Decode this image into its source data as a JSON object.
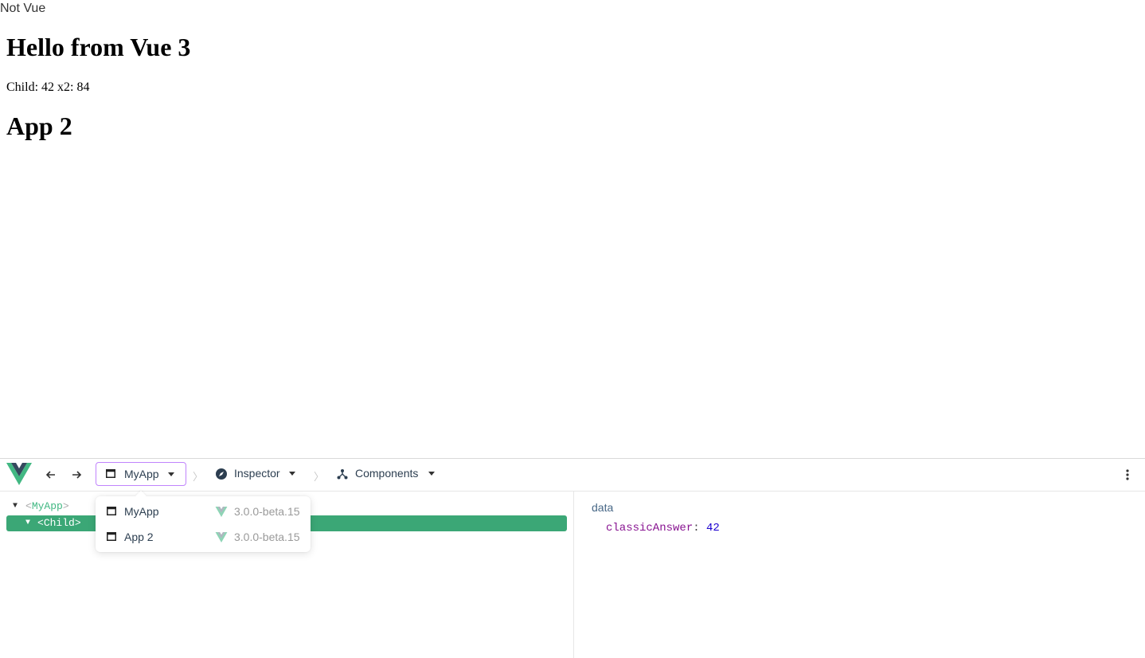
{
  "page": {
    "not_vue_text": "Not Vue",
    "heading": "Hello from Vue 3",
    "child_line": "Child: 42 x2: 84",
    "app2_heading": "App 2"
  },
  "devtools": {
    "toolbar": {
      "app_select_label": "MyApp",
      "inspector_label": "Inspector",
      "components_label": "Components",
      "separator": "〉"
    },
    "tree": {
      "root_tag": "MyApp",
      "child_tag": "Child"
    },
    "state": {
      "section_title": "data",
      "key": "classicAnswer",
      "value": "42"
    },
    "app_dropdown": [
      {
        "name": "MyApp",
        "version": "3.0.0-beta.15"
      },
      {
        "name": "App 2",
        "version": "3.0.0-beta.15"
      }
    ]
  },
  "colors": {
    "vue_green": "#42b883",
    "selected_row": "#3ba776",
    "select_border": "#c084fc"
  }
}
